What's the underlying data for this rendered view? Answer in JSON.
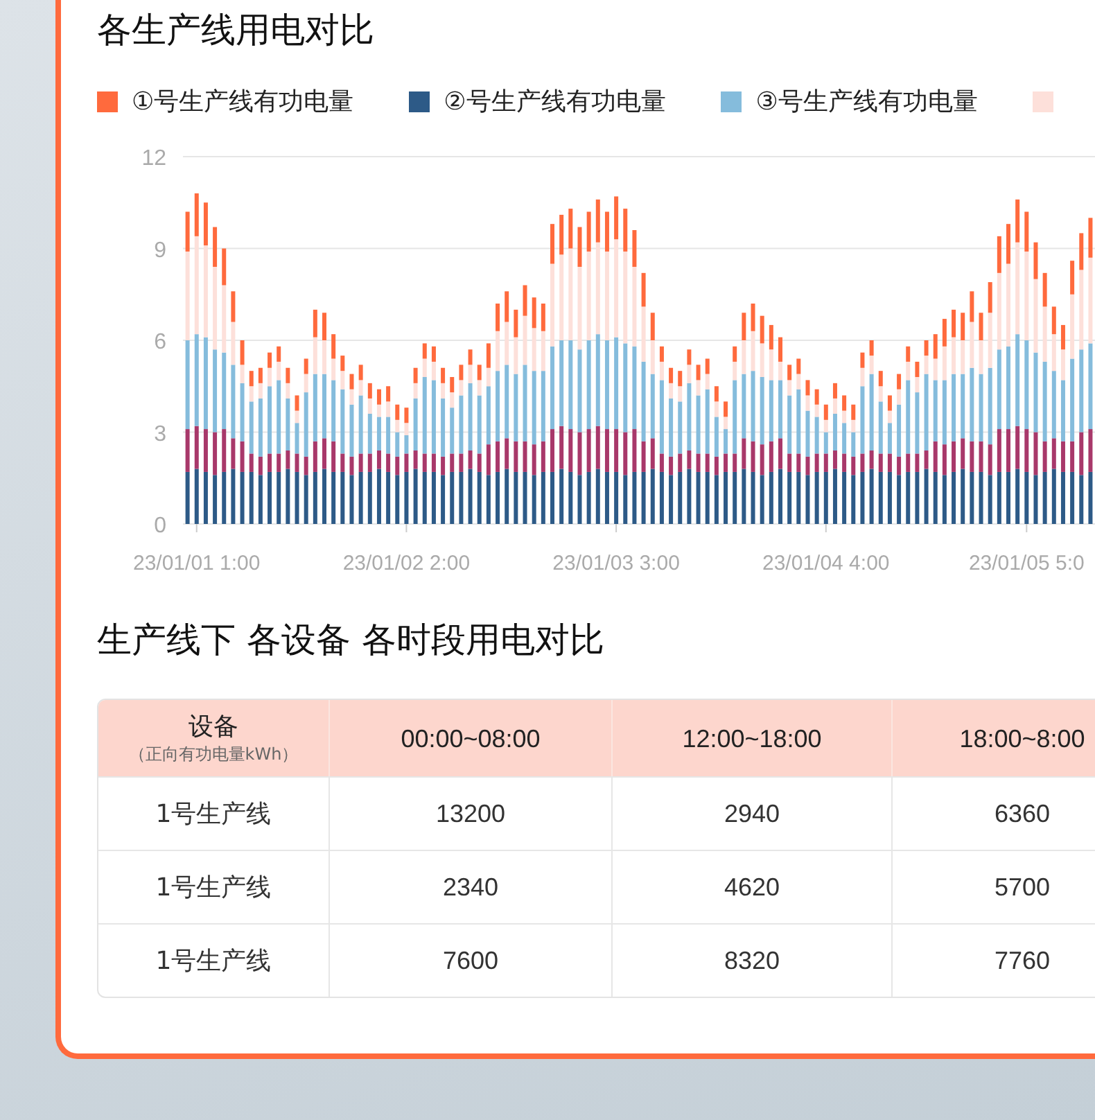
{
  "chart": {
    "title": "各生产线用电对比",
    "legend": [
      {
        "label": "①号生产线有功电量",
        "color": "#ff6a3d"
      },
      {
        "label": "②号生产线有功电量",
        "color": "#2d5a87"
      },
      {
        "label": "③号生产线有功电量",
        "color": "#85bcdc"
      },
      {
        "color": "#fde0da"
      }
    ],
    "chart_data": {
      "type": "bar",
      "stacked": true,
      "grid": true,
      "yticks": [
        0,
        3,
        6,
        9,
        12
      ],
      "ylim": [
        0,
        12
      ],
      "categories": [
        null,
        "23/01/01 1:00",
        null,
        null,
        null,
        null,
        null,
        null,
        null,
        null,
        null,
        null,
        null,
        null,
        null,
        null,
        null,
        null,
        null,
        null,
        null,
        null,
        null,
        null,
        "23/01/02 2:00",
        null,
        null,
        null,
        null,
        null,
        null,
        null,
        null,
        null,
        null,
        null,
        null,
        null,
        null,
        null,
        null,
        null,
        null,
        null,
        null,
        null,
        null,
        "23/01/03 3:00",
        null,
        null,
        null,
        null,
        null,
        null,
        null,
        null,
        null,
        null,
        null,
        null,
        null,
        null,
        null,
        null,
        null,
        null,
        null,
        null,
        null,
        null,
        "23/01/04 4:00",
        null,
        null,
        null,
        null,
        null,
        null,
        null,
        null,
        null,
        null,
        null,
        null,
        null,
        null,
        null,
        null,
        null,
        null,
        null,
        null,
        null,
        "23/01/05 5:0",
        null,
        null,
        null,
        null,
        null,
        null,
        null
      ],
      "series": [
        {
          "color": "#2d5a87",
          "values": [
            1.7,
            1.8,
            1.7,
            1.6,
            1.7,
            1.8,
            1.7,
            1.7,
            1.6,
            1.7,
            1.7,
            1.8,
            1.7,
            1.6,
            1.7,
            1.8,
            1.7,
            1.7,
            1.6,
            1.7,
            1.7,
            1.8,
            1.7,
            1.6,
            1.7,
            1.8,
            1.7,
            1.7,
            1.6,
            1.7,
            1.7,
            1.8,
            1.7,
            1.6,
            1.7,
            1.8,
            1.7,
            1.7,
            1.6,
            1.7,
            1.7,
            1.8,
            1.7,
            1.6,
            1.7,
            1.8,
            1.7,
            1.7,
            1.6,
            1.7,
            1.7,
            1.8,
            1.7,
            1.6,
            1.7,
            1.8,
            1.7,
            1.7,
            1.6,
            1.7,
            1.7,
            1.8,
            1.7,
            1.6,
            1.7,
            1.8,
            1.7,
            1.7,
            1.6,
            1.7,
            1.7,
            1.8,
            1.7,
            1.6,
            1.7,
            1.8,
            1.7,
            1.7,
            1.6,
            1.7,
            1.7,
            1.8,
            1.7,
            1.6,
            1.7,
            1.8,
            1.7,
            1.7,
            1.6,
            1.7,
            1.7,
            1.8,
            1.7,
            1.6,
            1.7,
            1.8,
            1.7,
            1.7,
            1.6,
            1.7
          ]
        },
        {
          "color": "#a8386a",
          "values": [
            1.4,
            1.4,
            1.4,
            1.4,
            1.4,
            1.0,
            1.0,
            0.6,
            0.6,
            0.6,
            0.6,
            0.6,
            0.6,
            0.6,
            1.0,
            1.0,
            1.0,
            0.6,
            0.6,
            0.6,
            0.6,
            0.6,
            0.6,
            0.6,
            0.6,
            0.6,
            0.6,
            0.6,
            0.6,
            0.6,
            0.6,
            0.6,
            0.6,
            1.0,
            1.0,
            1.0,
            1.0,
            1.0,
            1.0,
            1.0,
            1.4,
            1.4,
            1.4,
            1.4,
            1.4,
            1.4,
            1.4,
            1.4,
            1.4,
            1.4,
            1.0,
            1.0,
            0.6,
            0.6,
            0.6,
            0.6,
            0.6,
            0.6,
            0.6,
            0.6,
            0.6,
            1.0,
            1.0,
            1.0,
            1.0,
            1.0,
            0.6,
            0.6,
            0.6,
            0.6,
            0.6,
            0.6,
            0.6,
            0.6,
            0.6,
            0.6,
            0.6,
            0.6,
            0.6,
            0.6,
            0.6,
            0.6,
            1.0,
            1.0,
            1.0,
            1.0,
            1.0,
            1.0,
            1.0,
            1.4,
            1.4,
            1.4,
            1.4,
            1.4,
            1.0,
            1.0,
            1.0,
            1.0,
            1.4,
            1.4
          ]
        },
        {
          "color": "#85bcdc",
          "values": [
            2.9,
            3.0,
            3.0,
            2.7,
            2.5,
            2.4,
            1.9,
            1.7,
            1.9,
            2.2,
            2.4,
            1.7,
            1.0,
            2.1,
            2.2,
            2.1,
            2.0,
            2.1,
            1.7,
            1.9,
            1.3,
            1.1,
            1.2,
            0.8,
            0.6,
            1.7,
            2.5,
            2.4,
            1.9,
            1.5,
            1.9,
            2.2,
            1.9,
            1.9,
            2.3,
            2.4,
            2.2,
            2.5,
            2.4,
            2.3,
            2.7,
            2.8,
            2.9,
            2.7,
            2.9,
            3.0,
            2.9,
            3.0,
            2.9,
            2.7,
            2.6,
            2.1,
            2.4,
            1.9,
            1.7,
            2.2,
            1.9,
            2.1,
            1.3,
            0.8,
            2.4,
            2.1,
            2.3,
            2.2,
            2.0,
            1.9,
            1.9,
            2.1,
            1.5,
            1.2,
            0.7,
            1.2,
            1.0,
            0.8,
            2.2,
            2.5,
            1.7,
            1.0,
            1.7,
            2.4,
            2.0,
            2.5,
            2.0,
            2.1,
            2.2,
            2.1,
            2.4,
            2.2,
            2.5,
            2.6,
            2.7,
            3.0,
            2.9,
            2.6,
            2.6,
            2.2,
            2.0,
            2.7,
            2.7,
            2.8
          ]
        },
        {
          "color": "#fde0da",
          "values": [
            2.9,
            3.2,
            3.0,
            2.7,
            2.2,
            1.4,
            0.6,
            0.5,
            0.5,
            0.6,
            0.6,
            0.5,
            0.4,
            0.6,
            1.2,
            1.1,
            0.7,
            0.6,
            0.5,
            0.5,
            0.5,
            0.4,
            0.5,
            0.4,
            0.4,
            0.5,
            0.6,
            0.6,
            0.5,
            0.5,
            0.5,
            0.6,
            0.5,
            0.6,
            1.3,
            1.4,
            1.2,
            1.6,
            1.4,
            1.3,
            2.7,
            2.8,
            3.0,
            2.7,
            2.9,
            3.0,
            2.9,
            3.2,
            3.0,
            2.6,
            1.8,
            1.1,
            0.6,
            0.5,
            0.5,
            0.6,
            0.5,
            0.5,
            0.5,
            0.4,
            0.6,
            1.1,
            1.3,
            1.1,
            1.0,
            0.6,
            0.5,
            0.5,
            0.5,
            0.4,
            0.4,
            0.5,
            0.4,
            0.4,
            0.6,
            0.6,
            0.5,
            0.4,
            0.5,
            0.6,
            0.5,
            0.6,
            0.7,
            1.1,
            1.2,
            1.1,
            1.5,
            1.1,
            1.8,
            2.5,
            2.7,
            3.0,
            2.9,
            2.4,
            1.8,
            1.2,
            1.0,
            2.1,
            2.6,
            2.8
          ]
        },
        {
          "color": "#ff6a3d",
          "values": [
            1.3,
            1.4,
            1.4,
            1.3,
            1.2,
            1.0,
            0.8,
            0.5,
            0.5,
            0.5,
            0.5,
            0.5,
            0.5,
            0.5,
            0.9,
            0.9,
            0.8,
            0.5,
            0.5,
            0.5,
            0.5,
            0.5,
            0.5,
            0.5,
            0.5,
            0.5,
            0.5,
            0.5,
            0.5,
            0.5,
            0.5,
            0.5,
            0.5,
            0.8,
            0.9,
            1.0,
            0.9,
            1.0,
            1.0,
            0.9,
            1.3,
            1.3,
            1.3,
            1.3,
            1.3,
            1.4,
            1.3,
            1.4,
            1.4,
            1.2,
            1.1,
            0.9,
            0.5,
            0.5,
            0.5,
            0.5,
            0.5,
            0.5,
            0.5,
            0.5,
            0.5,
            0.9,
            0.9,
            0.9,
            0.8,
            0.8,
            0.5,
            0.5,
            0.5,
            0.5,
            0.5,
            0.5,
            0.5,
            0.5,
            0.5,
            0.5,
            0.5,
            0.5,
            0.5,
            0.5,
            0.5,
            0.5,
            0.8,
            0.9,
            0.9,
            0.9,
            1.0,
            0.9,
            1.0,
            1.2,
            1.3,
            1.4,
            1.3,
            1.2,
            1.1,
            0.9,
            0.8,
            1.1,
            1.2,
            1.3
          ]
        }
      ]
    }
  },
  "table_section": {
    "title": "生产线下 各设备 各时段用电对比",
    "columns": [
      {
        "label": "设备",
        "sublabel": "（正向有功电量kWh）"
      },
      {
        "label": "00:00~08:00"
      },
      {
        "label": "12:00~18:00"
      },
      {
        "label": "18:00~8:00"
      }
    ],
    "rows": [
      {
        "cells": [
          "1号生产线",
          "13200",
          "2940",
          "6360"
        ]
      },
      {
        "cells": [
          "1号生产线",
          "2340",
          "4620",
          "5700"
        ]
      },
      {
        "cells": [
          "1号生产线",
          "7600",
          "8320",
          "7760"
        ]
      }
    ]
  }
}
